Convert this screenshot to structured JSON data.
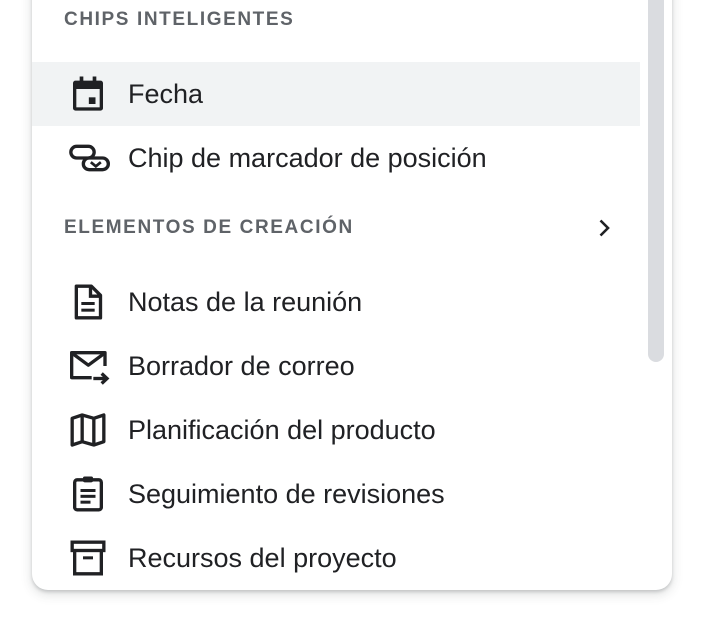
{
  "sections": [
    {
      "title": "CHIPS INTELIGENTES",
      "items": [
        {
          "label": "Fecha",
          "icon": "calendar-icon",
          "selected": true
        },
        {
          "label": "Chip de marcador de posición",
          "icon": "placeholder-chip-icon",
          "selected": false
        }
      ]
    },
    {
      "title": "ELEMENTOS DE CREACIÓN",
      "items": [
        {
          "label": "Notas de la reunión",
          "icon": "document-icon"
        },
        {
          "label": "Borrador de correo",
          "icon": "mail-forward-icon"
        },
        {
          "label": "Planificación del producto",
          "icon": "map-icon"
        },
        {
          "label": "Seguimiento de revisiones",
          "icon": "clipboard-icon"
        },
        {
          "label": "Recursos del proyecto",
          "icon": "archive-box-icon"
        }
      ]
    }
  ],
  "colors": {
    "text": "#202124",
    "header": "#5f6368",
    "selected_bg": "#f1f3f4",
    "scrollbar": "#dadce0"
  }
}
